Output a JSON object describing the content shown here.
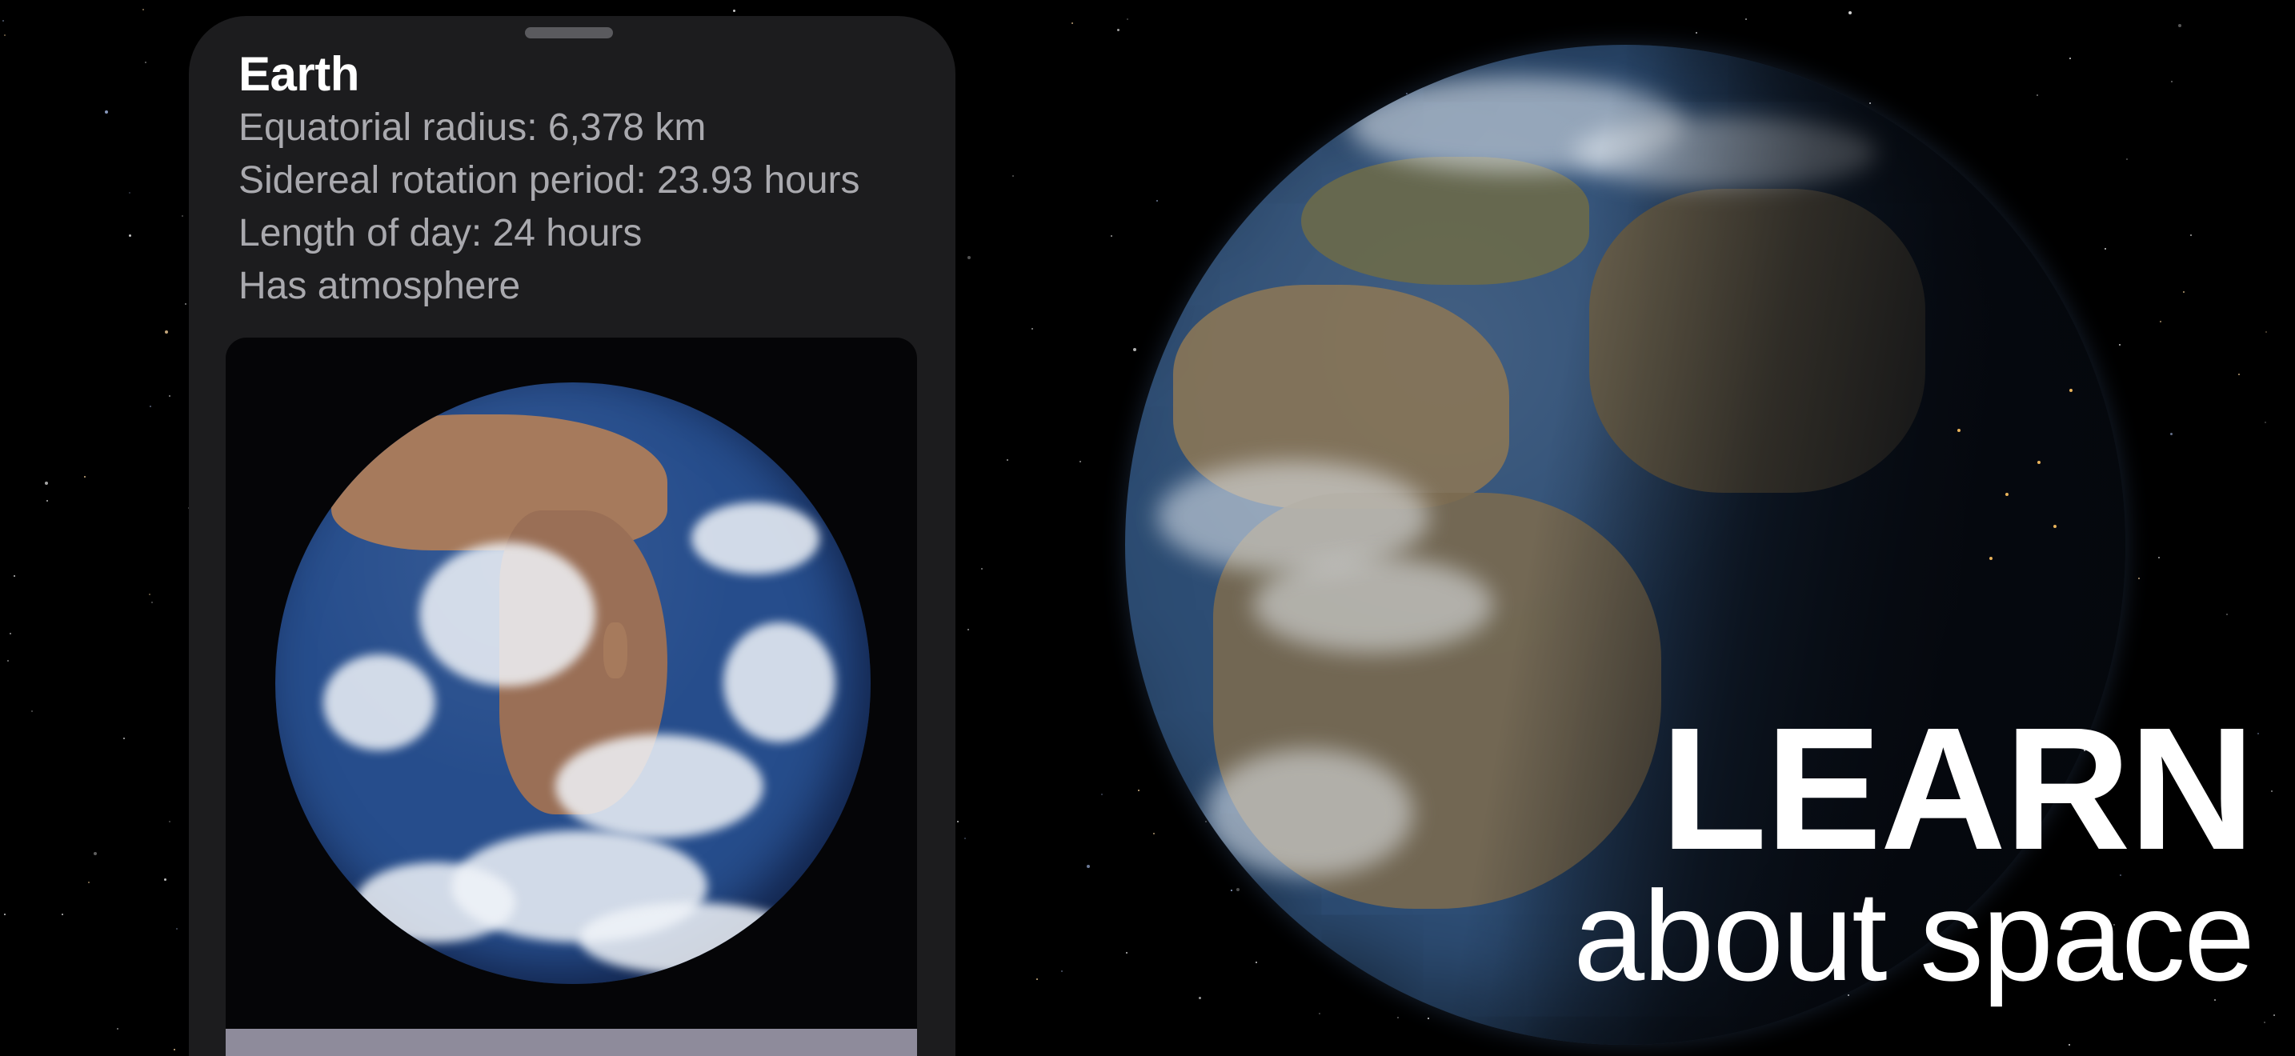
{
  "planet": {
    "name": "Earth",
    "equatorial_radius": "Equatorial radius: 6,378 km",
    "sidereal_rotation": "Sidereal rotation period: 23.93 hours",
    "length_of_day": "Length of day: 24 hours",
    "atmosphere": "Has atmosphere"
  },
  "promo": {
    "headline": "LEARN",
    "subline": "about space"
  },
  "colors": {
    "background": "#000000",
    "sheet": "#1c1c1e",
    "secondary_text": "#a9a9ae",
    "bottom_bar": "#8e8b9b"
  }
}
